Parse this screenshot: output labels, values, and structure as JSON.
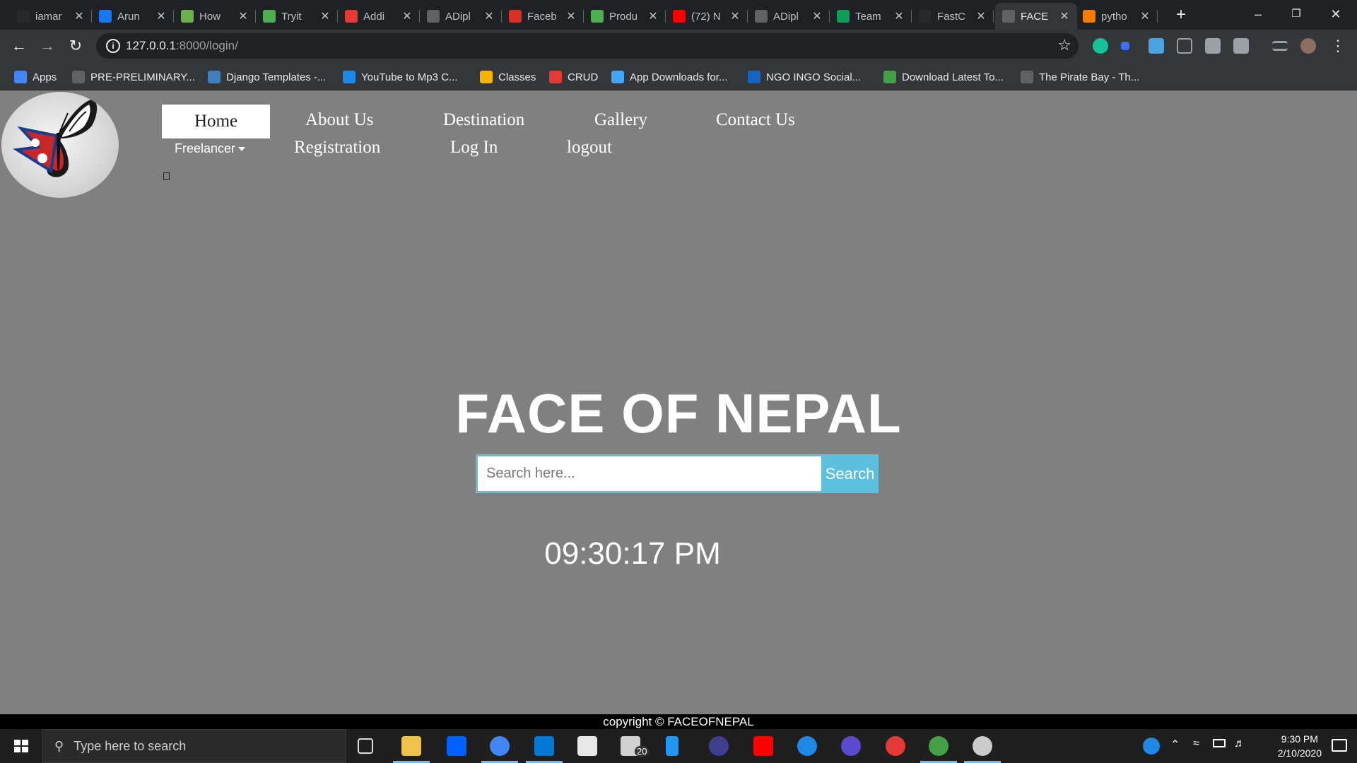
{
  "tabs": [
    {
      "title": "iamar",
      "color": "#24292e",
      "icon": "github-icon"
    },
    {
      "title": "Arun",
      "color": "#1877f2",
      "icon": "facebook-icon"
    },
    {
      "title": "How",
      "color": "#6ab04c",
      "icon": "wikihow-icon"
    },
    {
      "title": "Tryit",
      "color": "#4caf50",
      "icon": "w3schools-icon"
    },
    {
      "title": "Addi",
      "color": "#e53935",
      "icon": "angular-icon"
    },
    {
      "title": "ADipl",
      "color": "#5f6368",
      "icon": "globe-icon"
    },
    {
      "title": "Faceb",
      "color": "#d93025",
      "icon": "album-icon"
    },
    {
      "title": "Produ",
      "color": "#4caf50",
      "icon": "upwork-icon"
    },
    {
      "title": "(72) N",
      "color": "#ff0000",
      "icon": "youtube-icon"
    },
    {
      "title": "ADipl",
      "color": "#5f6368",
      "icon": "contact-icon"
    },
    {
      "title": "Team",
      "color": "#0f9d58",
      "icon": "sheets-icon"
    },
    {
      "title": "FastC",
      "color": "#24292e",
      "icon": "github-icon"
    },
    {
      "title": "FACE",
      "color": "#5f6368",
      "icon": "globe-icon",
      "active": true
    },
    {
      "title": "pytho",
      "color": "#f57c00",
      "icon": "java-icon"
    }
  ],
  "toolbar": {
    "url_host": "127.0.0.1",
    "url_path": ":8000/login/"
  },
  "bookmarks": [
    {
      "label": "Apps",
      "color": "#4285f4",
      "icon": "apps-grid-icon"
    },
    {
      "label": "PRE-PRELIMINARY...",
      "color": "#5f6368",
      "icon": "globe-icon"
    },
    {
      "label": "Django Templates -...",
      "color": "#3f7fbf",
      "icon": "django-icon"
    },
    {
      "label": "YouTube to Mp3 C...",
      "color": "#1e88e5",
      "icon": "download-cloud-icon"
    },
    {
      "label": "Classes",
      "color": "#f4b400",
      "icon": "classroom-icon"
    },
    {
      "label": "CRUD",
      "color": "#e53935",
      "icon": "vuetify-icon"
    },
    {
      "label": "App Downloads for...",
      "color": "#42a5f5",
      "icon": "app-download-icon"
    },
    {
      "label": "NGO INGO Social...",
      "color": "#1565c0",
      "icon": "jn-icon"
    },
    {
      "label": "Download Latest To...",
      "color": "#43a047",
      "icon": "utorrent-icon"
    },
    {
      "label": "The Pirate Bay - Th...",
      "color": "#5f6368",
      "icon": "pirate-icon"
    }
  ],
  "site": {
    "nav_row1": [
      "Home",
      "About Us",
      "Destination",
      "Gallery",
      "Contact Us"
    ],
    "nav_row2": [
      "Registration",
      "Log In",
      "logout"
    ],
    "freelancer": "Freelancer",
    "hero_title": "FACE OF NEPAL",
    "search_placeholder": "Search here...",
    "search_button": "Search",
    "clock": "09:30:17 PM",
    "footer": "copyright © FACEOFNEPAL"
  },
  "taskbar": {
    "search_placeholder": "Type here to search",
    "mail_badge": "20",
    "time": "9:30 PM",
    "date": "2/10/2020"
  }
}
